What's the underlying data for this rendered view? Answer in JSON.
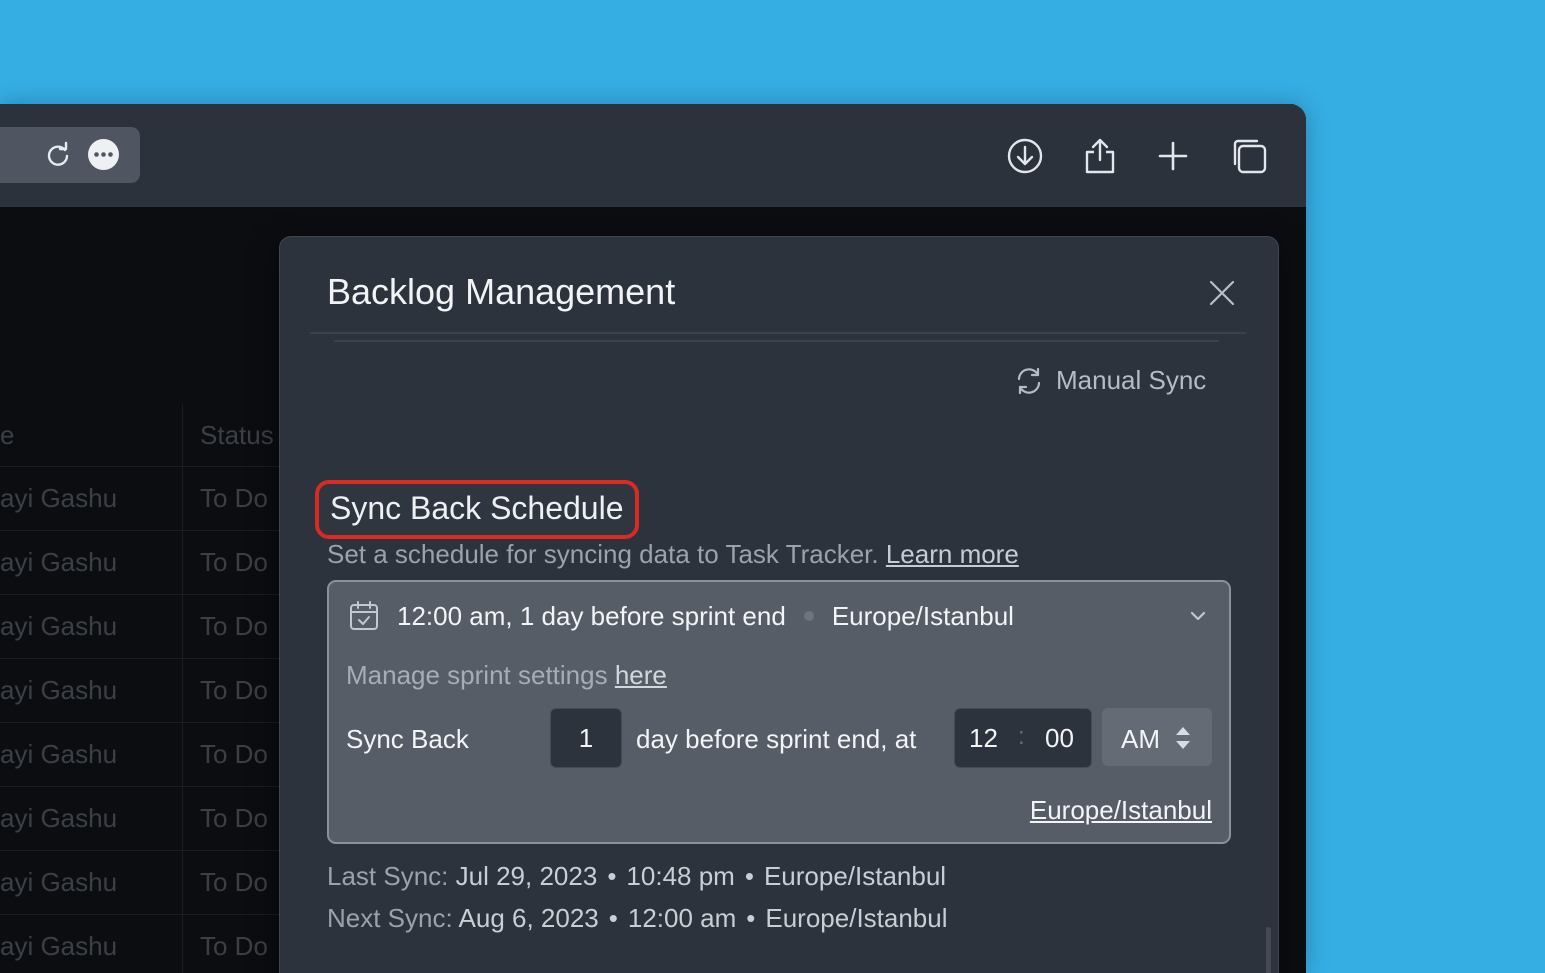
{
  "background_table": {
    "header_name_fragment": "e",
    "header_status": "Status",
    "rows": [
      {
        "name": "ayi Gashu",
        "status": "To Do"
      },
      {
        "name": "ayi Gashu",
        "status": "To Do"
      },
      {
        "name": "ayi Gashu",
        "status": "To Do"
      },
      {
        "name": "ayi Gashu",
        "status": "To Do"
      },
      {
        "name": "ayi Gashu",
        "status": "To Do"
      },
      {
        "name": "ayi Gashu",
        "status": "To Do"
      },
      {
        "name": "ayi Gashu",
        "status": "To Do"
      },
      {
        "name": "ayi Gashu",
        "status": "To Do"
      }
    ]
  },
  "browser": {
    "icons": [
      "reload-icon",
      "more-icon",
      "download-icon",
      "share-icon",
      "new-tab-icon",
      "tabs-overview-icon"
    ]
  },
  "modal": {
    "title": "Backlog Management",
    "manual_sync_label": "Manual Sync",
    "section_title": "Sync Back Schedule",
    "section_desc": "Set a schedule for syncing data to Task Tracker.",
    "learn_more": "Learn more",
    "schedule_summary_time": "12:00 am, 1 day before sprint end",
    "schedule_summary_tz": "Europe/Istanbul",
    "manage_text": "Manage sprint settings",
    "manage_link": "here",
    "sync_back_label": "Sync Back",
    "days_value": "1",
    "day_text": "day before sprint end, at",
    "hour": "12",
    "colon": ":",
    "minute": "00",
    "ampm": "AM",
    "timezone_link": "Europe/Istanbul",
    "last_sync_label": "Last Sync:",
    "last_sync_date": "Jul 29, 2023",
    "last_sync_time": "10:48 pm",
    "last_sync_tz": "Europe/Istanbul",
    "next_sync_label": "Next Sync:",
    "next_sync_date": "Aug 6, 2023",
    "next_sync_time": "12:00 am",
    "next_sync_tz": "Europe/Istanbul",
    "bullet": "•"
  },
  "colors": {
    "desktop": "#35aee4",
    "highlight_border": "#d92b21",
    "modal_bg": "#2c333d"
  }
}
